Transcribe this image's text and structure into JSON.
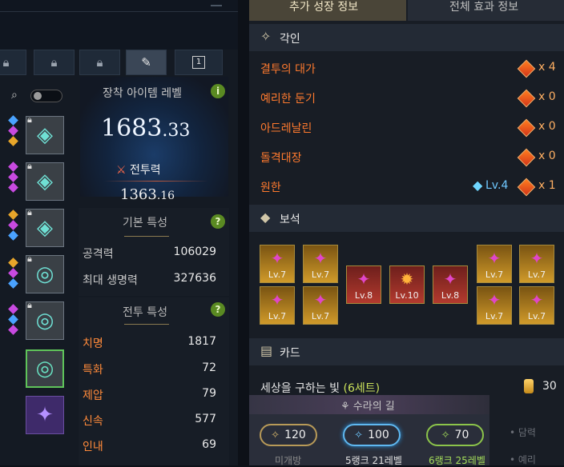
{
  "equip_icons": {
    "lock": "lock-icon",
    "edit": "edit-icon",
    "preset": "preset-1-icon",
    "preset_num": "1"
  },
  "search": {
    "icon": "search-icon",
    "toggle": "off"
  },
  "item_level": {
    "label": "장착 아이템 레벨",
    "value_int": "1683",
    "value_dec": ".33",
    "info": "i"
  },
  "power": {
    "label": "전투력",
    "value_int": "1363",
    "value_dec": ".16"
  },
  "basic_stats": {
    "title": "기본 특성",
    "help": "?",
    "rows": [
      {
        "label": "공격력",
        "value": "106029"
      },
      {
        "label": "최대 생명력",
        "value": "327636"
      }
    ]
  },
  "combat_stats": {
    "title": "전투 특성",
    "help": "?",
    "rows": [
      {
        "label": "치명",
        "value": "1817"
      },
      {
        "label": "특화",
        "value": "72"
      },
      {
        "label": "제압",
        "value": "79"
      },
      {
        "label": "신속",
        "value": "577"
      },
      {
        "label": "인내",
        "value": "69"
      }
    ]
  },
  "tabs": [
    {
      "label": "추가 성장 정보",
      "active": true
    },
    {
      "label": "전체 효과 정보",
      "active": false
    }
  ],
  "engraving": {
    "title": "각인",
    "items": [
      {
        "name": "결투의 대가",
        "count": "4"
      },
      {
        "name": "예리한 둔기",
        "count": "0"
      },
      {
        "name": "아드레날린",
        "count": "0"
      },
      {
        "name": "돌격대장",
        "count": "0"
      },
      {
        "name": "원한",
        "count": "1",
        "stone_level": "Lv.4"
      }
    ],
    "x_prefix": "x"
  },
  "gems": {
    "title": "보석",
    "items": [
      {
        "level": "Lv.7",
        "color": "yellow"
      },
      {
        "level": "Lv.7",
        "color": "yellow"
      },
      {
        "level": "Lv.7",
        "color": "yellow"
      },
      {
        "level": "Lv.7",
        "color": "yellow"
      },
      {
        "level": "Lv.7",
        "color": "yellow"
      },
      {
        "level": "Lv.7",
        "color": "yellow"
      },
      {
        "level": "Lv.7",
        "color": "yellow"
      },
      {
        "level": "Lv.7",
        "color": "yellow"
      },
      {
        "level": "Lv.8",
        "color": "red"
      },
      {
        "level": "Lv.10",
        "color": "red"
      },
      {
        "level": "Lv.8",
        "color": "red"
      }
    ]
  },
  "card": {
    "title": "카드",
    "set_name": "세상을 구하는 빛",
    "set_count": "(6세트)",
    "awaken": "30"
  },
  "ark": {
    "title": "수라의 길",
    "nodes": [
      {
        "value": "120",
        "caption": "미개방",
        "color": "#d9b86b"
      },
      {
        "value": "100",
        "caption": "5랭크 21레벨",
        "color": "#6fc8ff"
      },
      {
        "value": "70",
        "caption": "6랭크 25레벨",
        "color": "#a4dd5a"
      }
    ]
  },
  "right_edge": {
    "item1": "• 담력",
    "item2": "• 예리"
  },
  "colors": {
    "engrave_name": "#ff7a2e",
    "set_count": "#c9e05a",
    "item_level": "#e8f2ff"
  }
}
